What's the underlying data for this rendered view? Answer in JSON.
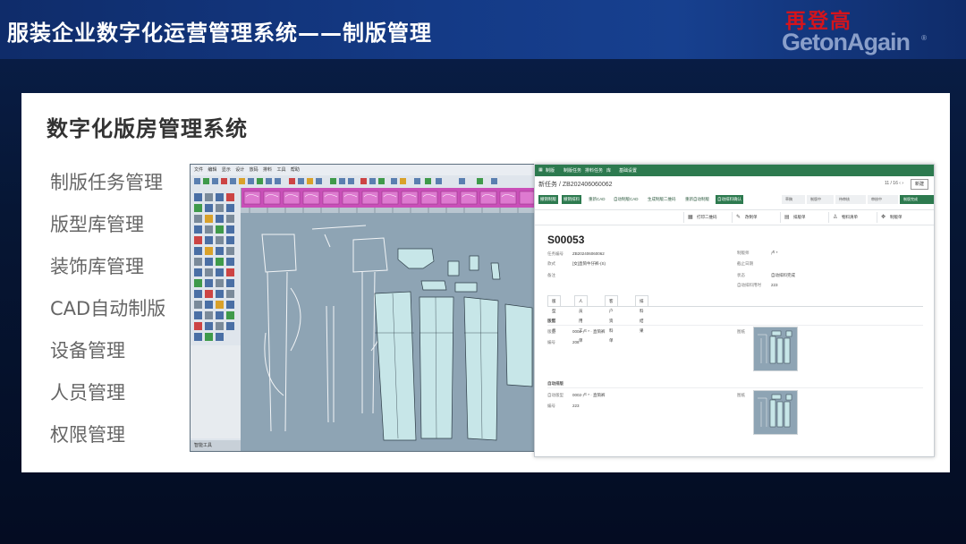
{
  "header": {
    "title": "服装企业数字化运营管理系统——制版管理",
    "logo_cn": "再登高",
    "logo_en": "GetonAgain",
    "logo_tm": "®"
  },
  "slide": {
    "title": "数字化版房管理系统",
    "menu": [
      "制版任务管理",
      "版型库管理",
      "装饰库管理",
      "CAD自动制版",
      "设备管理",
      "人员管理",
      "权限管理"
    ]
  },
  "cad": {
    "menu": [
      "文件",
      "编辑",
      "显示",
      "设计",
      "放码",
      "排料",
      "工具",
      "帮助"
    ],
    "status": "智能工具"
  },
  "web": {
    "topbar": [
      "制版",
      "制版任务",
      "排料任务",
      "库",
      "基础设置"
    ],
    "breadcrumb": "新任务 / ZB202406060062",
    "pager": "11 / 16",
    "new_button": "新建",
    "actions": [
      "撤销制版",
      "撤销排料",
      "重新CAD",
      "自动制版CAD",
      "生成制版二维码",
      "重新自动制版",
      "自动排料确认"
    ],
    "steps": [
      "草稿",
      "制版中",
      "待审核",
      "审核中",
      "制版完成"
    ],
    "smart_buttons": [
      "打印二维码",
      "改制单",
      "排版单",
      "物料清单",
      "制版单"
    ],
    "record_title": "S00053",
    "fields_left": [
      {
        "label": "任务编号",
        "value": "ZB202406060062"
      },
      {
        "label": "款式",
        "value": "[女]直筒牛仔裤-(S)"
      },
      {
        "label": "备注",
        "value": ""
      }
    ],
    "fields_right": [
      {
        "label": "制版师",
        "value": "卢 *"
      },
      {
        "label": "截止日期",
        "value": ""
      },
      {
        "label": "状态",
        "value": "自动排料完成"
      },
      {
        "label": "自动排料用时",
        "value": "223"
      }
    ],
    "tabs": [
      "版型信息",
      "人员用工单",
      "客户资料单",
      "排料结果"
    ],
    "section1": {
      "title": "版型",
      "label": "版型",
      "value": "0002-卢 * · 直筒裤",
      "label2": "编号",
      "value2": "208",
      "img_label": "图纸"
    },
    "section2": {
      "title": "自动排版",
      "label": "自动版型",
      "value": "0002-卢 * · 直筒裤",
      "label2": "编号",
      "value2": "223",
      "img_label": "图纸"
    }
  }
}
